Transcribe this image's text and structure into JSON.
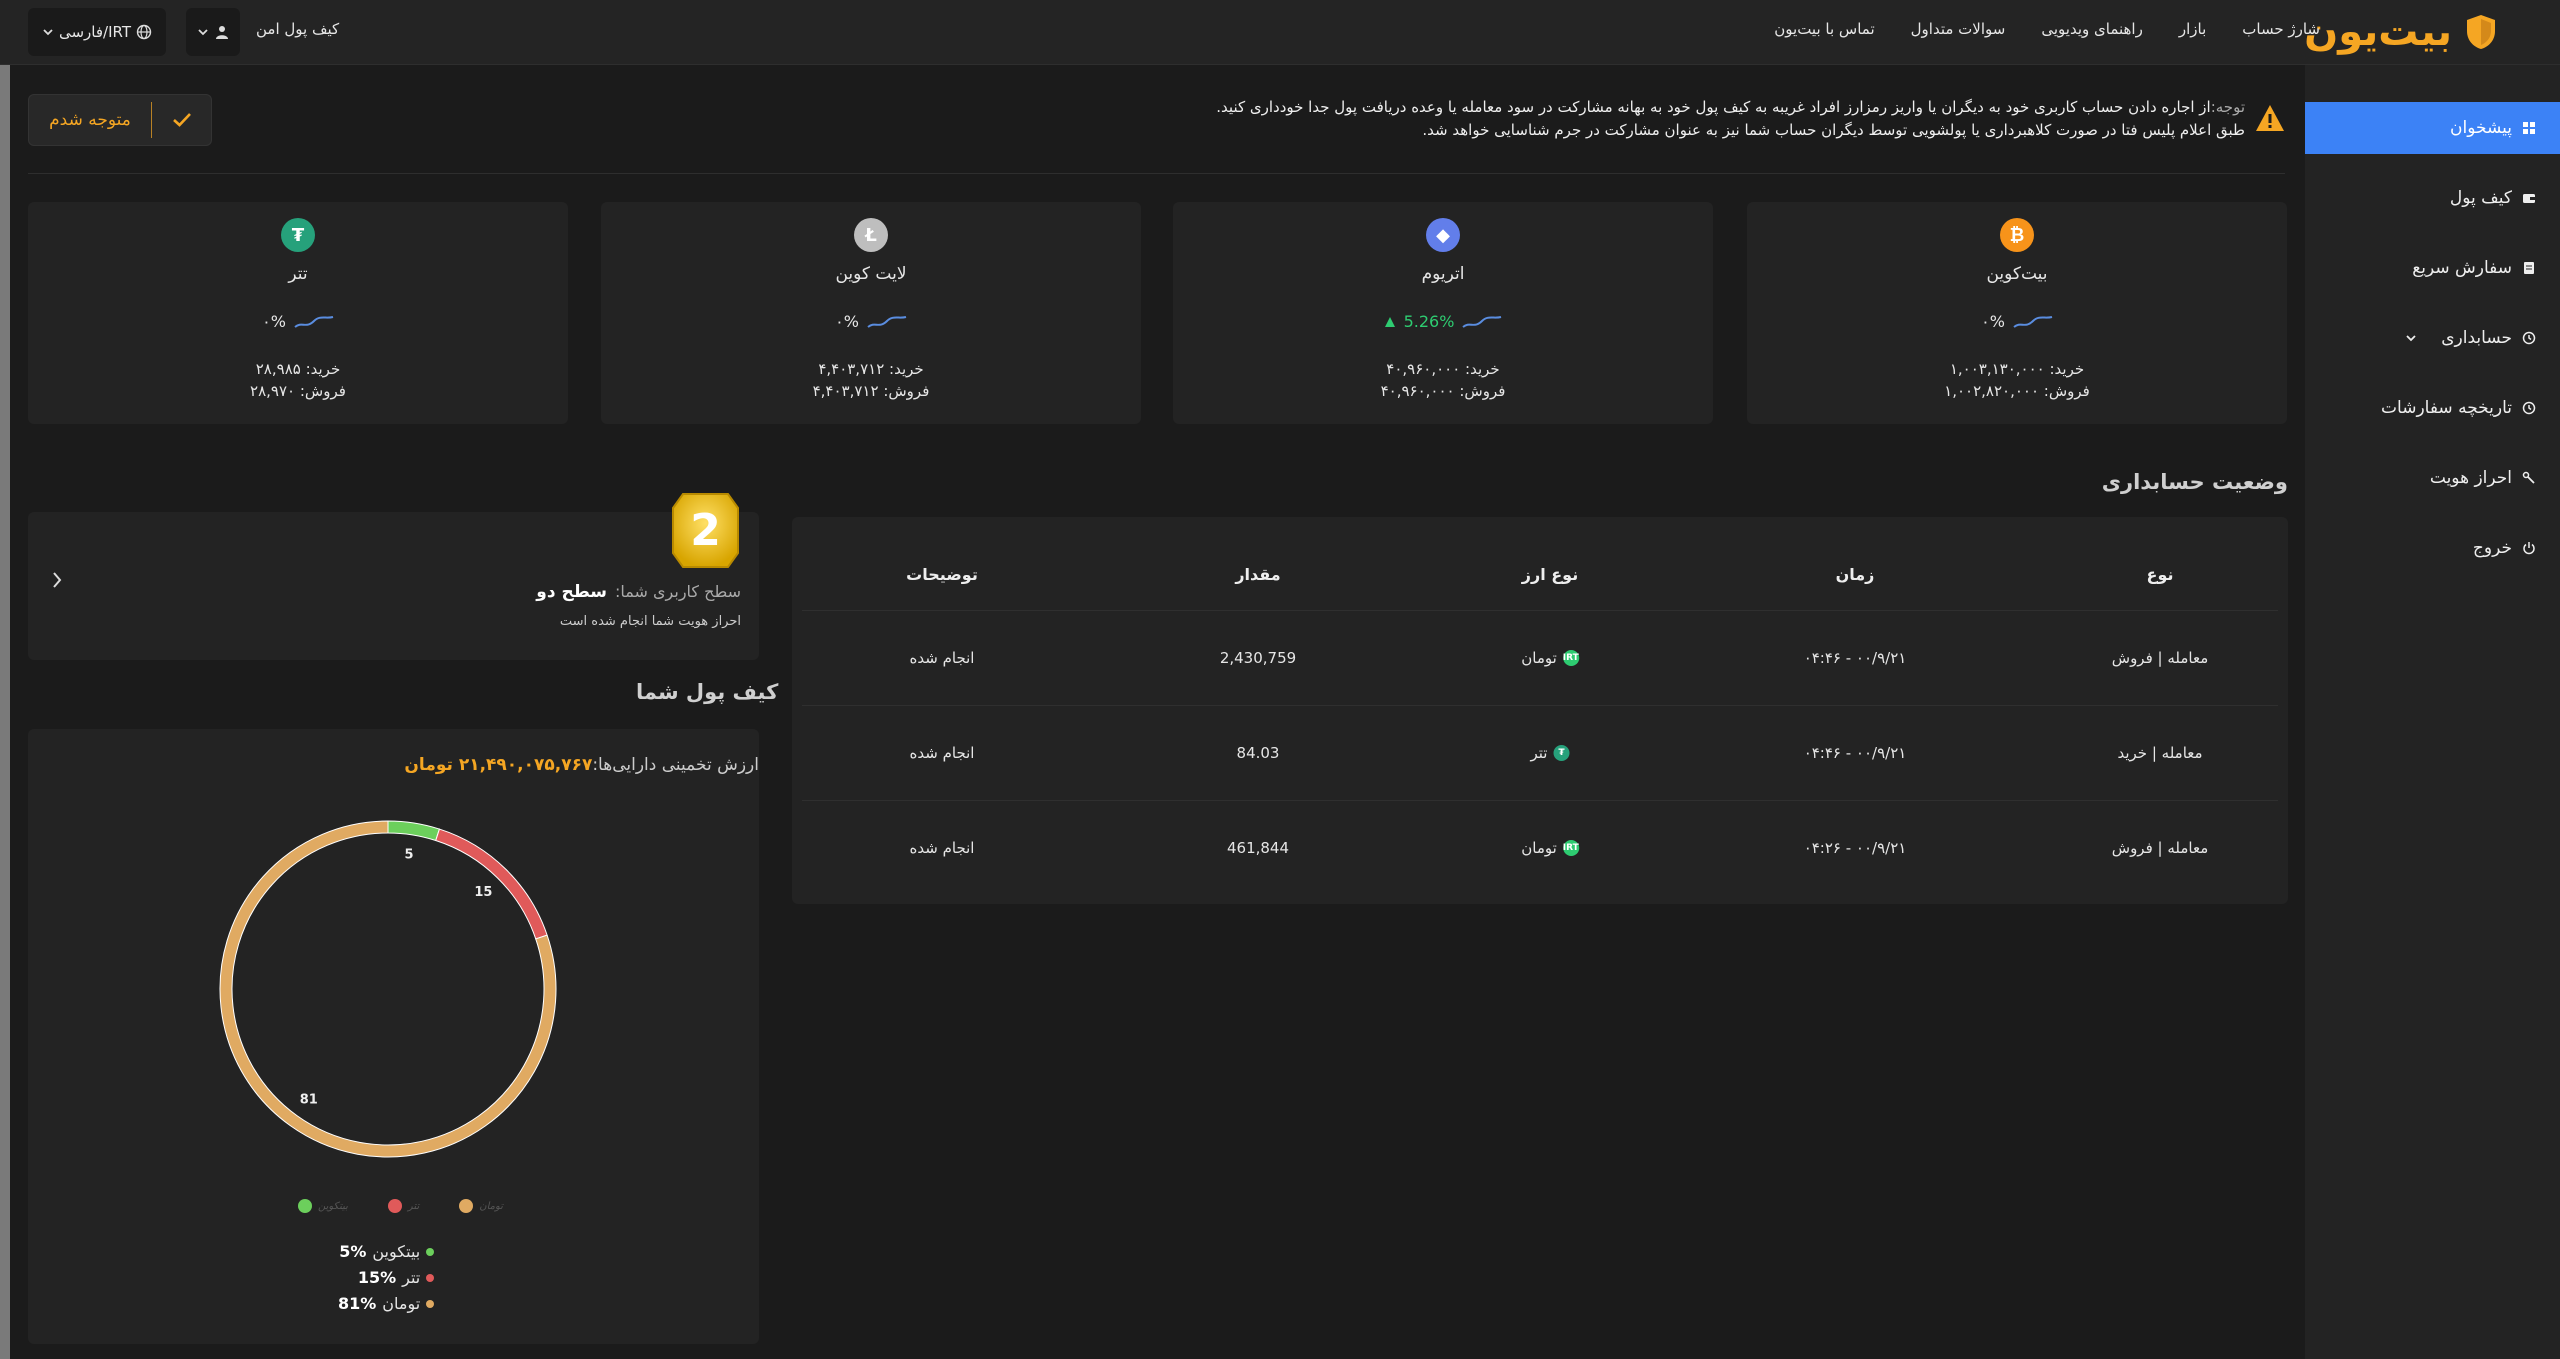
{
  "header": {
    "brand": "بیت‌یون",
    "nav": [
      "شارژ حساب",
      "بازار",
      "راهنمای ویدیویی",
      "سوالات متداول",
      "تماس با بیت‌یون"
    ],
    "wallet_link": "کیف پول امن",
    "language": "فارسی/IRT"
  },
  "sidebar": {
    "items": [
      {
        "label": "پیشخوان",
        "icon": "dashboard-icon",
        "active": true
      },
      {
        "label": "کیف پول",
        "icon": "wallet-icon"
      },
      {
        "label": "سفارش سریع",
        "icon": "receipt-icon"
      },
      {
        "label": "حسابداری",
        "icon": "history-icon",
        "has_submenu": true
      },
      {
        "label": "تاریخچه سفارشات",
        "icon": "history-icon"
      },
      {
        "label": "احراز هویت",
        "icon": "key-icon"
      },
      {
        "label": "خروج",
        "icon": "power-icon"
      }
    ]
  },
  "alert": {
    "prefix": "توجه:",
    "line1": "از اجاره دادن حساب کاربری خود به دیگران یا واریز رمزارز افراد غریبه به کیف پول خود به بهانه مشارکت در سود معامله یا وعده دریافت پول جدا خودداری کنید.",
    "line2": "طبق اعلام پلیس فتا در صورت کلاهبرداری یا پولشویی توسط دیگران حساب شما نیز به عنوان مشارکت در جرم شناسایی خواهد شد.",
    "ack_label": "متوجه شدم"
  },
  "coins": [
    {
      "name": "بیت‌کوین",
      "symbol": "₿",
      "color": "#f7931a",
      "change": "۰%",
      "trend": "flat",
      "buy": "خرید: ۱,۰۰۳,۱۳۰,۰۰۰",
      "sell": "فروش: ۱,۰۰۲,۸۲۰,۰۰۰"
    },
    {
      "name": "اتریوم",
      "symbol": "◆",
      "color": "#627eea",
      "change": "5.26%",
      "trend": "up",
      "buy": "خرید: ۴۰,۹۶۰,۰۰۰",
      "sell": "فروش: ۴۰,۹۶۰,۰۰۰"
    },
    {
      "name": "لایت کوین",
      "symbol": "Ł",
      "color": "#bebebe",
      "change": "۰%",
      "trend": "flat",
      "buy": "خرید: ۴,۴۰۳,۷۱۲",
      "sell": "فروش: ۴,۴۰۳,۷۱۲"
    },
    {
      "name": "تتر",
      "symbol": "₮",
      "color": "#26a17b",
      "change": "۰%",
      "trend": "flat",
      "buy": "خرید: ۲۸,۹۸۵",
      "sell": "فروش: ۲۸,۹۷۰"
    }
  ],
  "accounting": {
    "title": "وضعیت حسابداری",
    "headers": [
      "نوع",
      "زمان",
      "نوع ارز",
      "مقدار",
      "توضیحات"
    ],
    "rows": [
      {
        "type": "معامله | فروش",
        "time": "۰۰/۹/۲۱ - ۰۴:۴۶",
        "currency": "تومان",
        "cur_icon": "IRT",
        "cur_color": "#2ecc71",
        "amount": "2,430,759",
        "desc": "انجام شده"
      },
      {
        "type": "معامله | خرید",
        "time": "۰۰/۹/۲۱ - ۰۴:۴۶",
        "currency": "تتر",
        "cur_icon": "₮",
        "cur_color": "#26a17b",
        "amount": "84.03",
        "desc": "انجام شده"
      },
      {
        "type": "معامله | فروش",
        "time": "۰۰/۹/۲۱ - ۰۴:۲۶",
        "currency": "تومان",
        "cur_icon": "IRT",
        "cur_color": "#2ecc71",
        "amount": "461,844",
        "desc": "انجام شده"
      }
    ]
  },
  "level": {
    "badge": "2",
    "label": "سطح کاربری شما:",
    "value": "سطح دو",
    "status": "احراز هویت شما انجام شده است"
  },
  "wallet": {
    "title": "کیف پول شما",
    "est_label": "ارزش تخمینی دارایی‌ها:",
    "est_value": "۲۱,۴۹۰,۰۷۵,۷۶۷ تومان"
  },
  "chart_data": {
    "type": "pie",
    "series": [
      {
        "name": "بیتکوین",
        "value": 5,
        "color": "#6ccf5c"
      },
      {
        "name": "تتر",
        "value": 15,
        "color": "#e05a5a"
      },
      {
        "name": "تومان",
        "value": 81,
        "color": "#e0aa62"
      }
    ],
    "percent_labels": [
      "5%",
      "15%",
      "81%"
    ],
    "legend_faint": [
      "بیتکوین",
      "تتر",
      "تومان"
    ]
  }
}
